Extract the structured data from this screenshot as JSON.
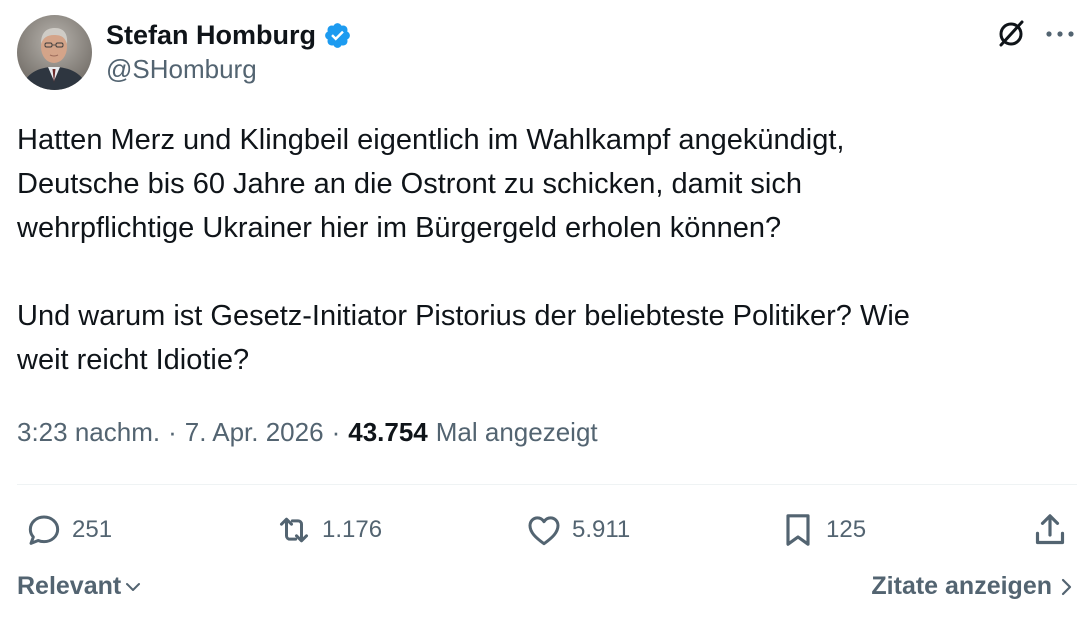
{
  "author": {
    "name": "Stefan Homburg",
    "handle": "@SHomburg",
    "verified": true,
    "verified_color": "#1d9bf0"
  },
  "tweet": {
    "text": "Hatten Merz und Klingbeil eigentlich im Wahlkampf angekündigt,\nDeutsche bis 60 Jahre an die Ostront zu schicken, damit sich\nwehrpflichtige Ukrainer hier im Bürgergeld erholen können?\n\nUnd warum ist Gesetz-Initiator Pistorius der beliebteste Politiker? Wie\nweit reicht Idiotie?",
    "time": "3:23 nachm.",
    "date": "7. Apr. 2026",
    "separator": "·",
    "views_count": "43.754",
    "views_label": "Mal angezeigt"
  },
  "actions": {
    "replies": "251",
    "reposts": "1.176",
    "likes": "5.911",
    "bookmarks": "125"
  },
  "footer": {
    "sort_label": "Relevant",
    "quotes_label": "Zitate anzeigen"
  },
  "icons": {
    "header": [
      "grok-icon",
      "more-icon"
    ],
    "actions": [
      "reply-icon",
      "repost-icon",
      "like-icon",
      "bookmark-icon",
      "share-icon"
    ],
    "footer": [
      "chevron-down-icon",
      "chevron-right-icon"
    ]
  },
  "colors": {
    "text_primary": "#0f1419",
    "text_secondary": "#536471",
    "divider": "#eff3f4",
    "accent": "#1d9bf0"
  }
}
